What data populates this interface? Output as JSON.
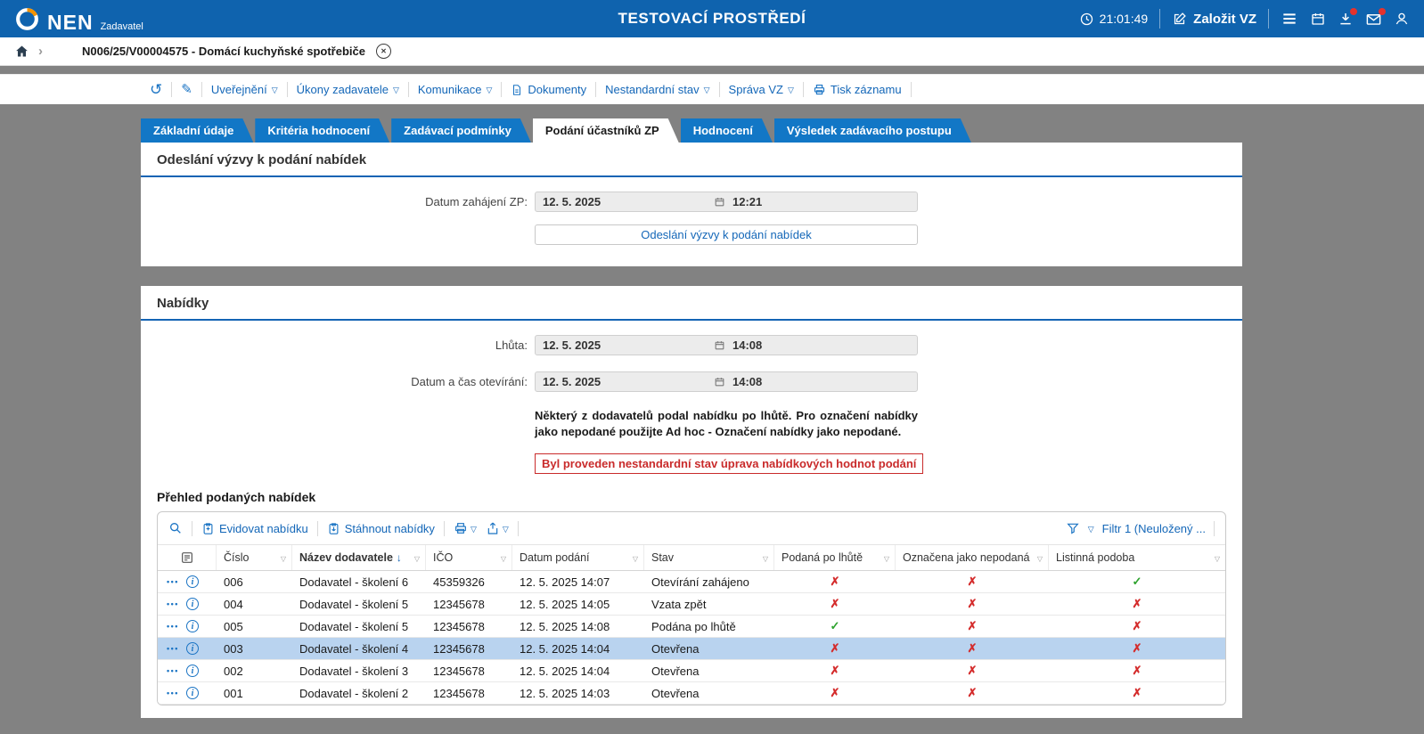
{
  "icons": {
    "caret": "▽",
    "refresh": "↺",
    "pencil": "✎",
    "chevron": "›",
    "sort_desc": "↓",
    "filter": "▽"
  },
  "header": {
    "brand": "NEN",
    "brand_sub": "Zadavatel",
    "title": "TESTOVACÍ PROSTŘEDÍ",
    "clock": "21:01:49",
    "create_vz": "Založit VZ"
  },
  "breadcrumb": {
    "item": "N006/25/V00004575 - Domácí kuchyňské spotřebiče"
  },
  "toolbar": {
    "menu": [
      "Uveřejnění",
      "Úkony zadavatele",
      "Komunikace",
      "Dokumenty",
      "Nestandardní stav",
      "Správa VZ",
      "Tisk záznamu"
    ]
  },
  "tabs": [
    {
      "label": "Základní údaje"
    },
    {
      "label": "Kritéria hodnocení"
    },
    {
      "label": "Zadávací podmínky"
    },
    {
      "label": "Podání účastníků ZP",
      "active": true
    },
    {
      "label": "Hodnocení"
    },
    {
      "label": "Výsledek zadávacího postupu"
    }
  ],
  "vyzva": {
    "title": "Odeslání výzvy k podání nabídek",
    "label": "Datum zahájení ZP:",
    "date": "12. 5. 2025",
    "time": "12:21",
    "button": "Odeslání výzvy k podání nabídek"
  },
  "nabidky": {
    "title": "Nabídky",
    "lhuta_label": "Lhůta:",
    "lhuta_date": "12. 5. 2025",
    "lhuta_time": "14:08",
    "otevirani_label": "Datum a čas otevírání:",
    "otevirani_date": "12. 5. 2025",
    "otevirani_time": "14:08",
    "note": "Některý z dodavatelů podal nabídku po lhůtě. Pro označení nabídky jako nepodané použijte Ad hoc - Označení nabídky jako nepodané.",
    "warning": "Byl proveden nestandardní stav úprava nabídkových hodnot podání",
    "table_title": "Přehled podaných nabídek"
  },
  "table": {
    "toolbar": {
      "evidovat": "Evidovat nabídku",
      "stahnout": "Stáhnout nabídky",
      "filter_label": "Filtr 1 (Neuložený ..."
    },
    "columns": [
      "Číslo",
      "Název dodavatele",
      "IČO",
      "Datum podání",
      "Stav",
      "Podaná po lhůtě",
      "Označena jako nepodaná",
      "Listinná podoba"
    ],
    "rows": [
      {
        "cislo": "006",
        "nazev": "Dodavatel - školení 6",
        "ico": "45359326",
        "datum": "12. 5. 2025 14:07",
        "stav": "Otevírání zahájeno",
        "po_lhute": "✗",
        "nepodana": "✗",
        "listinna": "✓"
      },
      {
        "cislo": "004",
        "nazev": "Dodavatel - školení 5",
        "ico": "12345678",
        "datum": "12. 5. 2025 14:05",
        "stav": "Vzata zpět",
        "po_lhute": "✗",
        "nepodana": "✗",
        "listinna": "✗"
      },
      {
        "cislo": "005",
        "nazev": "Dodavatel - školení 5",
        "ico": "12345678",
        "datum": "12. 5. 2025 14:08",
        "stav": "Podána po lhůtě",
        "po_lhute": "✓",
        "nepodana": "✗",
        "listinna": "✗"
      },
      {
        "cislo": "003",
        "nazev": "Dodavatel - školení 4",
        "ico": "12345678",
        "datum": "12. 5. 2025 14:04",
        "stav": "Otevřena",
        "po_lhute": "✗",
        "nepodana": "✗",
        "listinna": "✗",
        "selected": true
      },
      {
        "cislo": "002",
        "nazev": "Dodavatel - školení 3",
        "ico": "12345678",
        "datum": "12. 5. 2025 14:04",
        "stav": "Otevřena",
        "po_lhute": "✗",
        "nepodana": "✗",
        "listinna": "✗"
      },
      {
        "cislo": "001",
        "nazev": "Dodavatel - školení 2",
        "ico": "12345678",
        "datum": "12. 5. 2025 14:03",
        "stav": "Otevřena",
        "po_lhute": "✗",
        "nepodana": "✗",
        "listinna": "✗"
      }
    ]
  }
}
